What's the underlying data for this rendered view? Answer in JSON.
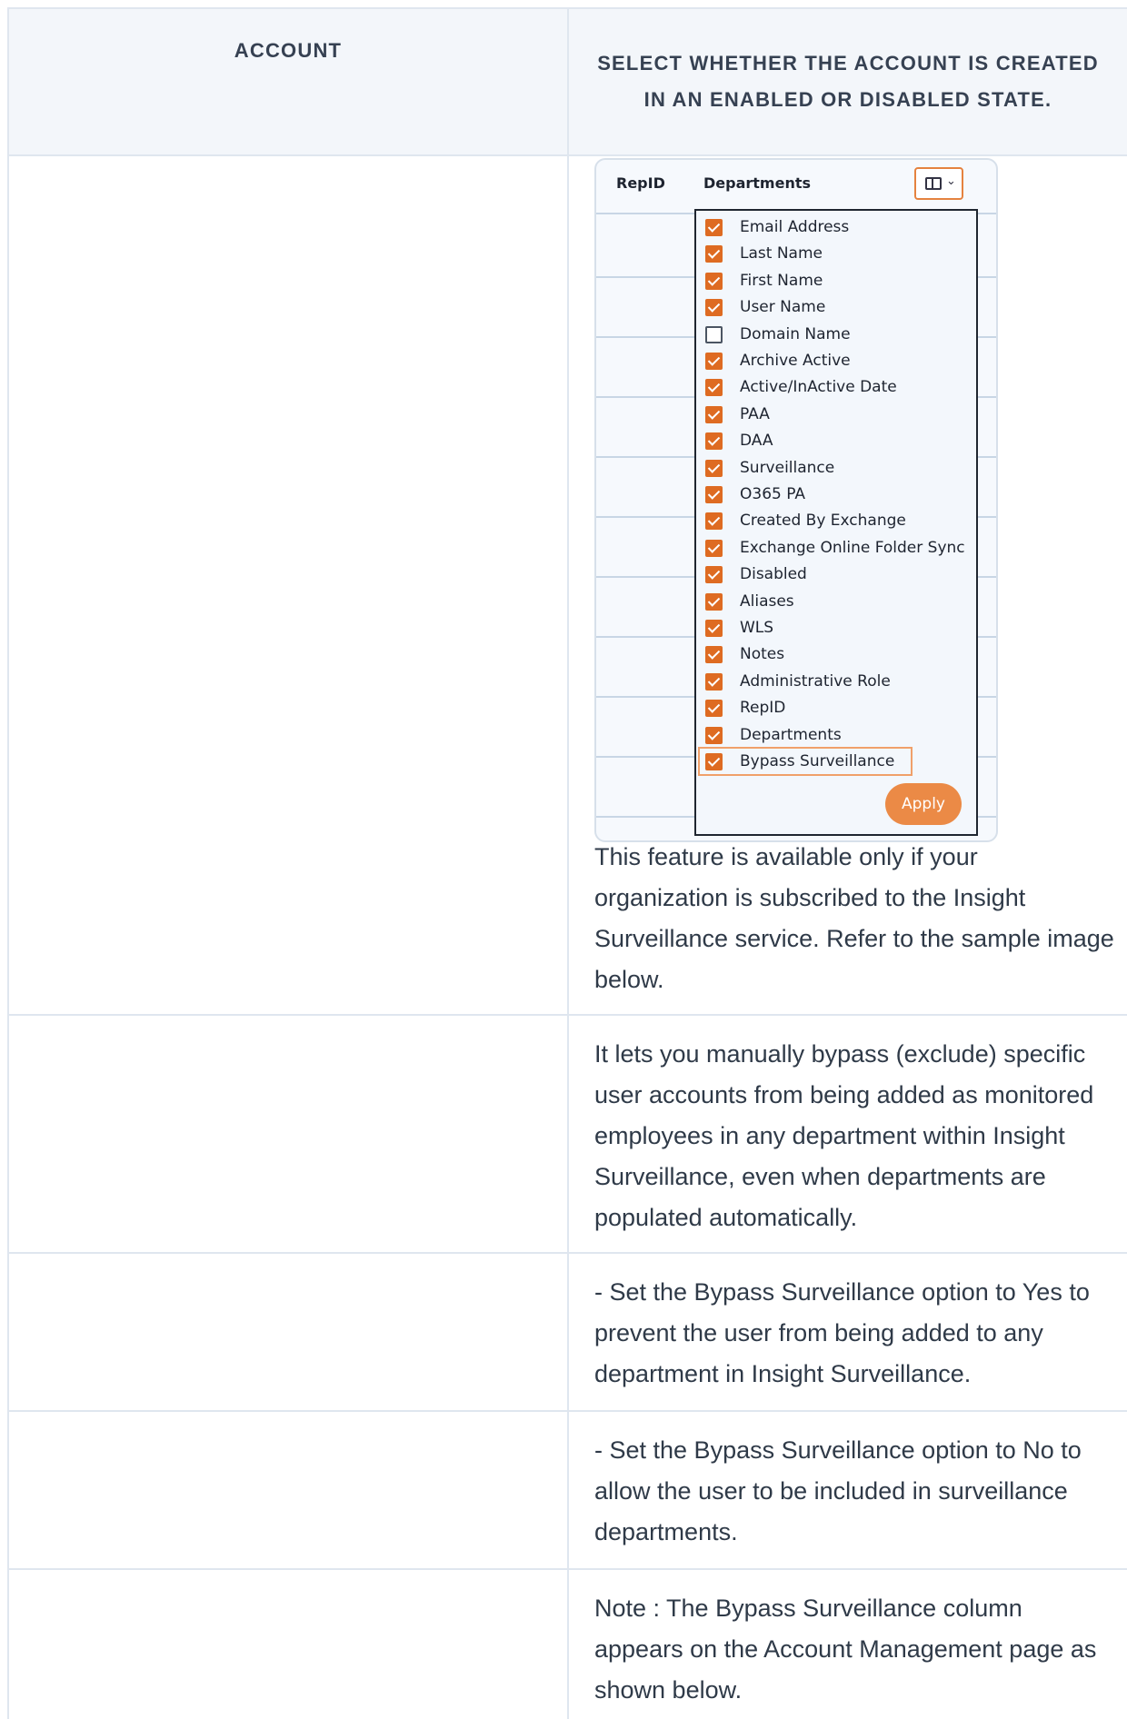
{
  "table": {
    "header": {
      "account": "ACCOUNT",
      "description": "SELECT WHETHER THE ACCOUNT IS CREATED IN AN ENABLED OR DISABLED STATE."
    },
    "rows": [
      {
        "text": "This feature is available only if your organization is subscribed to the Insight Surveillance service. Refer to the sample image below."
      },
      {
        "text": "It lets you manually bypass (exclude) specific user accounts from being added as monitored employees in any department within Insight Surveillance, even when departments are populated automatically."
      },
      {
        "text": "- Set the Bypass Surveillance option to Yes to prevent the user from being added to any department in Insight Surveillance."
      },
      {
        "text": "- Set the Bypass Surveillance option to No to allow the user to be included in surveillance departments."
      },
      {
        "text": "Note : The Bypass Surveillance column appears on the Account Management page as shown below."
      }
    ]
  },
  "column_chooser": {
    "columns": [
      "RepID",
      "Departments"
    ],
    "toggle_icon": "columns-icon",
    "chevron_icon": "chevron-down-icon",
    "options": [
      {
        "label": "Email Address",
        "checked": true
      },
      {
        "label": "Last Name",
        "checked": true
      },
      {
        "label": "First Name",
        "checked": true
      },
      {
        "label": "User Name",
        "checked": true
      },
      {
        "label": "Domain Name",
        "checked": false
      },
      {
        "label": "Archive Active",
        "checked": true
      },
      {
        "label": "Active/InActive Date",
        "checked": true
      },
      {
        "label": "PAA",
        "checked": true
      },
      {
        "label": "DAA",
        "checked": true
      },
      {
        "label": "Surveillance",
        "checked": true
      },
      {
        "label": "O365 PA",
        "checked": true
      },
      {
        "label": "Created By Exchange",
        "checked": true
      },
      {
        "label": "Exchange Online Folder Sync",
        "checked": true
      },
      {
        "label": "Disabled",
        "checked": true
      },
      {
        "label": "Aliases",
        "checked": true
      },
      {
        "label": "WLS",
        "checked": true
      },
      {
        "label": "Notes",
        "checked": true
      },
      {
        "label": "Administrative Role",
        "checked": true
      },
      {
        "label": "RepID",
        "checked": true
      },
      {
        "label": "Departments",
        "checked": true
      },
      {
        "label": "Bypass Surveillance",
        "checked": true,
        "highlighted": true
      }
    ],
    "apply_label": "Apply",
    "accent_color": "#de6b22"
  }
}
